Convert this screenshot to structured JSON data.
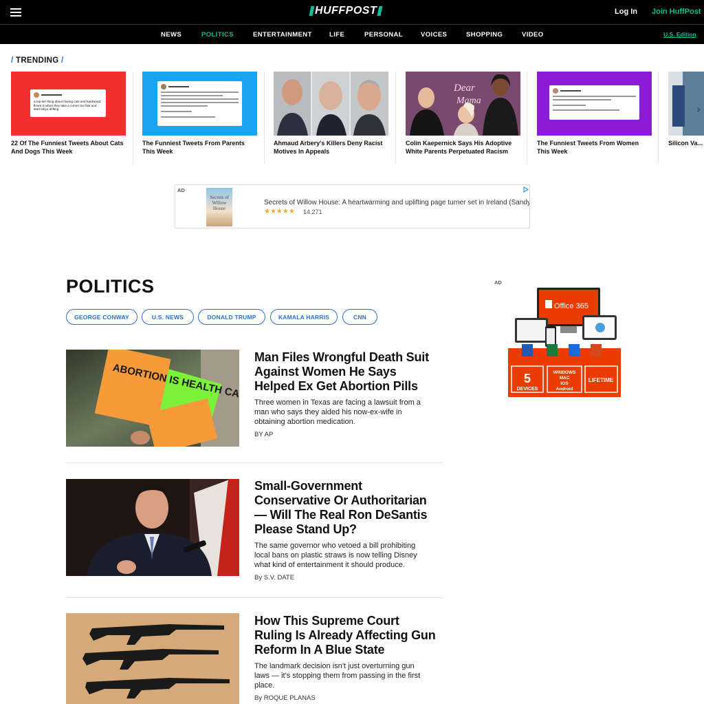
{
  "header": {
    "logo_text": "HUFFPOST",
    "login_label": "Log In",
    "join_label": "Join HuffPost"
  },
  "nav": {
    "items": [
      "NEWS",
      "POLITICS",
      "ENTERTAINMENT",
      "LIFE",
      "PERSONAL",
      "VOICES",
      "SHOPPING",
      "VIDEO"
    ],
    "active": "POLITICS",
    "edition_label": "U.S. Edition"
  },
  "trending": {
    "label": "TRENDING",
    "cards": [
      {
        "caption": "22 Of The Funniest Tweets About Cats And Dogs This Week",
        "bg": "#f42f2f"
      },
      {
        "caption": "The Funniest Tweets From Parents This Week",
        "bg": "#1aa3f0"
      },
      {
        "caption": "Ahmaud Arbery's Killers Deny Racist Motives In Appeals",
        "bg": "#8b8b8b"
      },
      {
        "caption": "Colin Kaepernick Says His Adoptive White Parents Perpetuated Racism",
        "bg": "#6a3f63"
      },
      {
        "caption": "The Funniest Tweets From Women This Week",
        "bg": "#8d1ad6"
      },
      {
        "caption": "Silicon Va... Deposito...",
        "bg": "#4a6f8f"
      }
    ],
    "tweet1_text": "a top-tier thing about having cats and hardwood floors is when they take a corner too fast and start tokyo drifting"
  },
  "ad_banner": {
    "tag": "AD",
    "book_title": "Secrets of Willow House",
    "text": "Secrets of Willow House: A heartwarming and uplifting page turner set in Ireland (Sandy",
    "stars": "★★★★★",
    "rating_count": "14,271"
  },
  "section": {
    "title": "POLITICS",
    "tags": [
      "GEORGE CONWAY",
      "U.S. NEWS",
      "DONALD TRUMP",
      "KAMALA HARRIS",
      "CNN"
    ]
  },
  "articles": [
    {
      "title": "Man Files Wrongful Death Suit Against Women He Says Helped Ex Get Abortion Pills",
      "desc": "Three women in Texas are facing a lawsuit from a man who says they aided his now-ex-wife in obtaining abortion medication.",
      "byline": "BY AP",
      "sign_text": "ABORTION IS HEALTH CARE"
    },
    {
      "title": "Small-Government Conservative Or Authoritarian — Will The Real Ron DeSantis Please Stand Up?",
      "desc": "The same governor who vetoed a bill prohibiting local bans on plastic straws is now telling Disney what kind of entertainment it should produce.",
      "byline": "By S.V. DATE"
    },
    {
      "title": "How This Supreme Court Ruling Is Already Affecting Gun Reform In A Blue State",
      "desc": "The landmark decision isn't just overturning gun laws — it's stopping them from passing in the first place.",
      "byline": "By ROQUE PLANAS"
    }
  ],
  "side_ad": {
    "tag": "AD",
    "brand": "Office 365",
    "box1_num": "5",
    "box1_label": "DEVICES",
    "box2_lines": [
      "WINDOWS",
      "MAC",
      "IOS",
      "Android"
    ],
    "box3_label": "LIFETIME"
  },
  "colors": {
    "accent": "#0dbe98",
    "link_blue": "#2b6fd1",
    "office_orange": "#eb3c00"
  }
}
